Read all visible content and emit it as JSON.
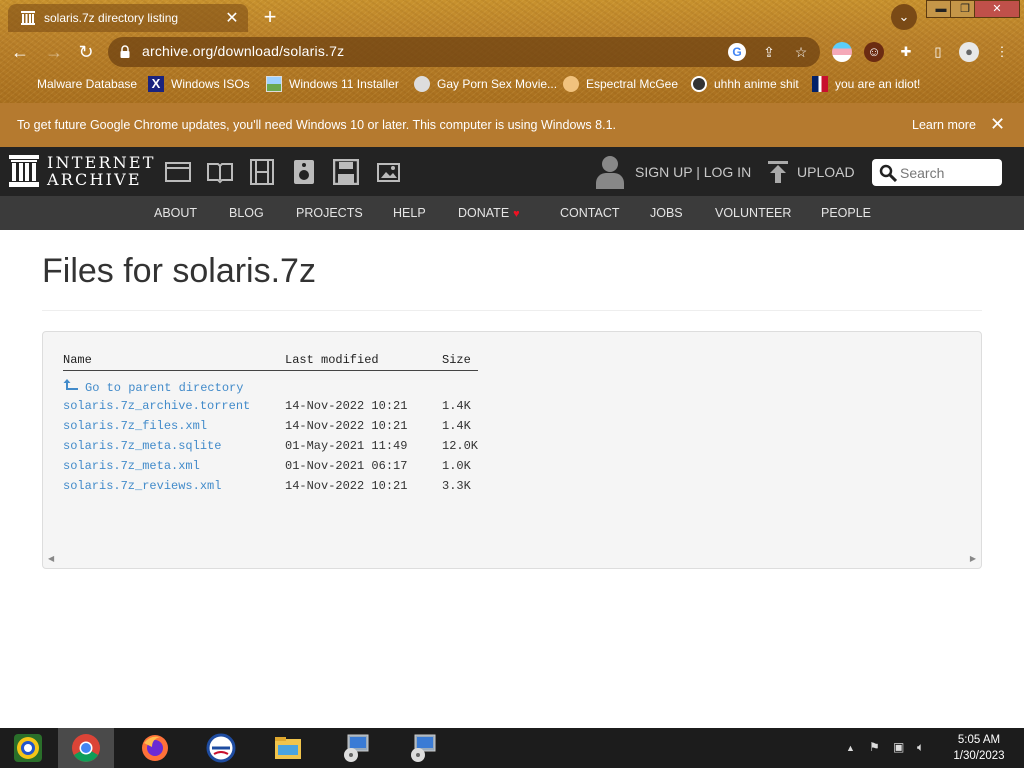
{
  "browser": {
    "tab": {
      "title": "solaris.7z directory listing",
      "close": "✕"
    },
    "new_tab": "+",
    "window_controls": {
      "minimize": "▬",
      "restore": "❐",
      "close": "✕"
    },
    "url": "archive.org/download/solaris.7z",
    "bookmarks": [
      {
        "label": "Malware Database",
        "icon": "blank-icon"
      },
      {
        "label": "Windows ISOs",
        "icon": "x-icon"
      },
      {
        "label": "Windows 11 Installer",
        "icon": "image-icon"
      },
      {
        "label": "Gay Porn Sex Movie...",
        "icon": "globe-icon"
      },
      {
        "label": "Espectral McGee",
        "icon": "face-icon"
      },
      {
        "label": "uhhh anime shit",
        "icon": "anime-icon"
      },
      {
        "label": "you are an idiot!",
        "icon": "flag-icon"
      }
    ],
    "colors": {
      "theme": "#b57a2f",
      "omnibox": "#6e4212"
    }
  },
  "infobar": {
    "message": "To get future Google Chrome updates, you'll need Windows 10 or later. This computer is using Windows 8.1.",
    "learn_more": "Learn more",
    "close": "✕"
  },
  "ia_header": {
    "logo_line1": "INTERNET",
    "logo_line2": "ARCHIVE",
    "media_icons": [
      "web-icon",
      "texts-icon",
      "video-icon",
      "audio-icon",
      "software-icon",
      "images-icon"
    ],
    "signup_login": "SIGN UP | LOG IN",
    "upload": "UPLOAD",
    "search_placeholder": "Search",
    "nav": [
      "ABOUT",
      "BLOG",
      "PROJECTS",
      "HELP",
      "DONATE",
      "CONTACT",
      "JOBS",
      "VOLUNTEER",
      "PEOPLE"
    ],
    "colors": {
      "top_bar": "#232323",
      "nav_bar": "#3b3b3b",
      "link": "#428bca",
      "heart": "#ee1122"
    }
  },
  "page": {
    "title": "Files for solaris.7z",
    "listing": {
      "headers": {
        "name": "Name",
        "modified": "Last modified",
        "size": "Size"
      },
      "parent_link": "Go to parent directory",
      "files": [
        {
          "name": "solaris.7z_archive.torrent",
          "modified": "14-Nov-2022 10:21",
          "size": "1.4K"
        },
        {
          "name": "solaris.7z_files.xml",
          "modified": "14-Nov-2022 10:21",
          "size": "1.4K"
        },
        {
          "name": "solaris.7z_meta.sqlite",
          "modified": "01-May-2021 11:49",
          "size": "12.0K"
        },
        {
          "name": "solaris.7z_meta.xml",
          "modified": "01-Nov-2021 06:17",
          "size": "1.0K"
        },
        {
          "name": "solaris.7z_reviews.xml",
          "modified": "14-Nov-2022 10:21",
          "size": "3.3K"
        }
      ]
    }
  },
  "taskbar": {
    "apps": [
      "chrome-alt-icon",
      "chrome-icon",
      "firefox-icon",
      "opera-icon",
      "file-explorer-icon",
      "installer-icon",
      "installer-icon"
    ],
    "clock": {
      "time": "5:05 AM",
      "date": "1/30/2023"
    }
  }
}
